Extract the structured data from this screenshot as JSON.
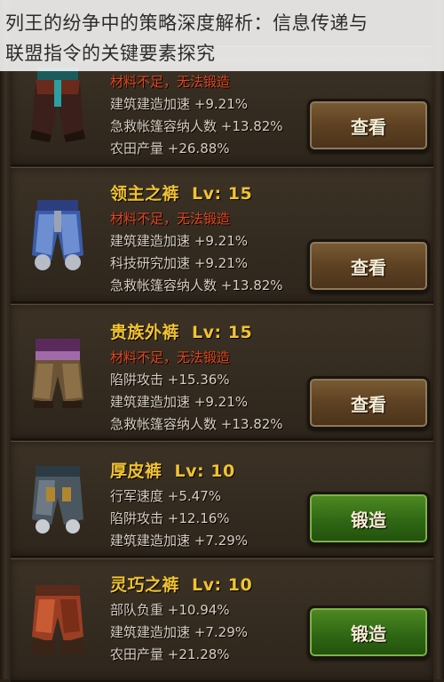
{
  "caption": {
    "line1": "列王的纷争中的策略深度解析：信息传递与",
    "line2": "联盟指令的关键要素探究"
  },
  "items": [
    {
      "name": "",
      "level": "",
      "lines": [
        {
          "text": "材料不足，无法锻造",
          "warn": true
        },
        {
          "text": "建筑建造加速 +9.21%",
          "warn": false
        },
        {
          "text": "急救帐篷容纳人数 +13.82%",
          "warn": false
        },
        {
          "text": "农田产量 +26.88%",
          "warn": false
        }
      ],
      "button": "查看",
      "button_type": "view",
      "icon": "dark-trousers-icon"
    },
    {
      "name": "领主之裤",
      "level": "Lv: 15",
      "lines": [
        {
          "text": "材料不足，无法锻造",
          "warn": true
        },
        {
          "text": "建筑建造加速 +9.21%",
          "warn": false
        },
        {
          "text": "科技研究加速 +9.21%",
          "warn": false
        },
        {
          "text": "急救帐篷容纳人数 +13.82%",
          "warn": false
        }
      ],
      "button": "查看",
      "button_type": "view",
      "icon": "lord-trousers-icon"
    },
    {
      "name": "贵族外裤",
      "level": "Lv: 15",
      "lines": [
        {
          "text": "材料不足，无法锻造",
          "warn": true
        },
        {
          "text": "陷阱攻击 +15.36%",
          "warn": false
        },
        {
          "text": "建筑建造加速 +9.21%",
          "warn": false
        },
        {
          "text": "急救帐篷容纳人数 +13.82%",
          "warn": false
        }
      ],
      "button": "查看",
      "button_type": "view",
      "icon": "noble-trousers-icon"
    },
    {
      "name": "厚皮裤",
      "level": "Lv: 10",
      "lines": [
        {
          "text": "行军速度 +5.47%",
          "warn": false
        },
        {
          "text": "陷阱攻击 +12.16%",
          "warn": false
        },
        {
          "text": "建筑建造加速 +7.29%",
          "warn": false
        }
      ],
      "button": "锻造",
      "button_type": "forge",
      "icon": "leather-trousers-icon"
    },
    {
      "name": "灵巧之裤",
      "level": "Lv: 10",
      "lines": [
        {
          "text": "部队负重 +10.94%",
          "warn": false
        },
        {
          "text": "建筑建造加速 +7.29%",
          "warn": false
        },
        {
          "text": "农田产量 +21.28%",
          "warn": false
        }
      ],
      "button": "锻造",
      "button_type": "forge",
      "icon": "agile-trousers-icon"
    }
  ]
}
